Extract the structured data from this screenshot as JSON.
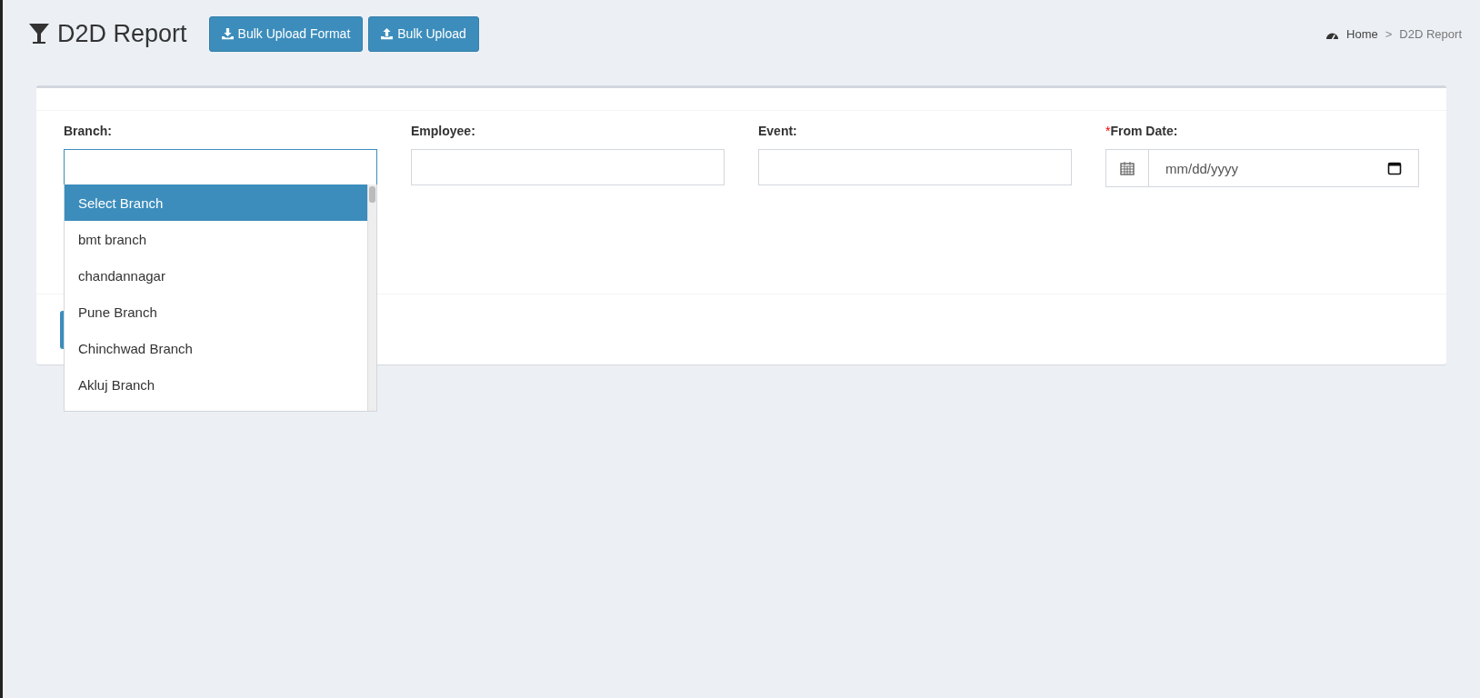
{
  "header": {
    "title": "D2D Report",
    "buttons": [
      {
        "label": "Bulk Upload Format",
        "kind": "download"
      },
      {
        "label": "Bulk Upload",
        "kind": "upload"
      }
    ]
  },
  "breadcrumb": [
    {
      "label": "Home",
      "kind": "link"
    },
    {
      "label": ">",
      "kind": "separator"
    },
    {
      "label": "D2D Report",
      "kind": "current"
    }
  ],
  "filters": [
    {
      "label": "Branch:",
      "kind": "select",
      "focused": true,
      "options": [
        {
          "label": "Select Branch",
          "selected": true
        },
        {
          "label": "bmt branch",
          "selected": false
        },
        {
          "label": "chandannagar",
          "selected": false
        },
        {
          "label": "Pune Branch",
          "selected": false
        },
        {
          "label": "Chinchwad Branch",
          "selected": false
        },
        {
          "label": "Akluj Branch",
          "selected": false
        }
      ]
    },
    {
      "label": "Employee:",
      "kind": "text",
      "focused": false
    },
    {
      "label": "Event:",
      "kind": "text",
      "focused": false
    },
    {
      "label": "From Date:",
      "required_mark": "*",
      "kind": "date",
      "placeholder": "mm/dd/yyyy",
      "focused": false
    }
  ]
}
